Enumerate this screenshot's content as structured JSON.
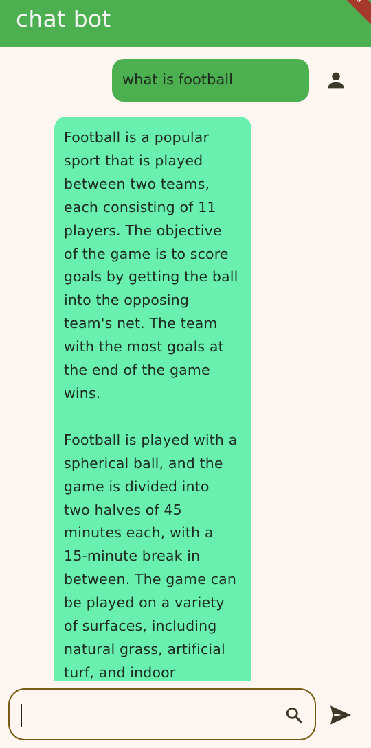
{
  "appbar": {
    "title": "chat bot",
    "debug_banner": "G"
  },
  "messages": [
    {
      "sender": "user",
      "text": "what is football",
      "avatar_icon": "person-icon"
    },
    {
      "sender": "bot",
      "text": "Football is a popular\nsport that is played\nbetween two teams,\neach consisting of 11\nplayers. The objective\nof the game is to score\ngoals by getting the ball\ninto the opposing\nteam's net. The team\nwith the most goals at\nthe end of the game\nwins.\n\nFootball is played with a\nspherical ball, and the\ngame is divided into\ntwo halves of 45\nminutes each, with a\n15-minute break in\nbetween. The game can\nbe played on a variety\nof surfaces, including\nnatural grass, artificial\nturf, and indoor"
    }
  ],
  "composer": {
    "value": "",
    "search_icon": "search-icon",
    "send_icon": "send-icon"
  },
  "colors": {
    "appbar": "#4caf50",
    "user_bubble": "#4caf50",
    "bot_bubble": "#69f0ae",
    "background": "#fff6f1",
    "input_border": "#7a5a14"
  }
}
